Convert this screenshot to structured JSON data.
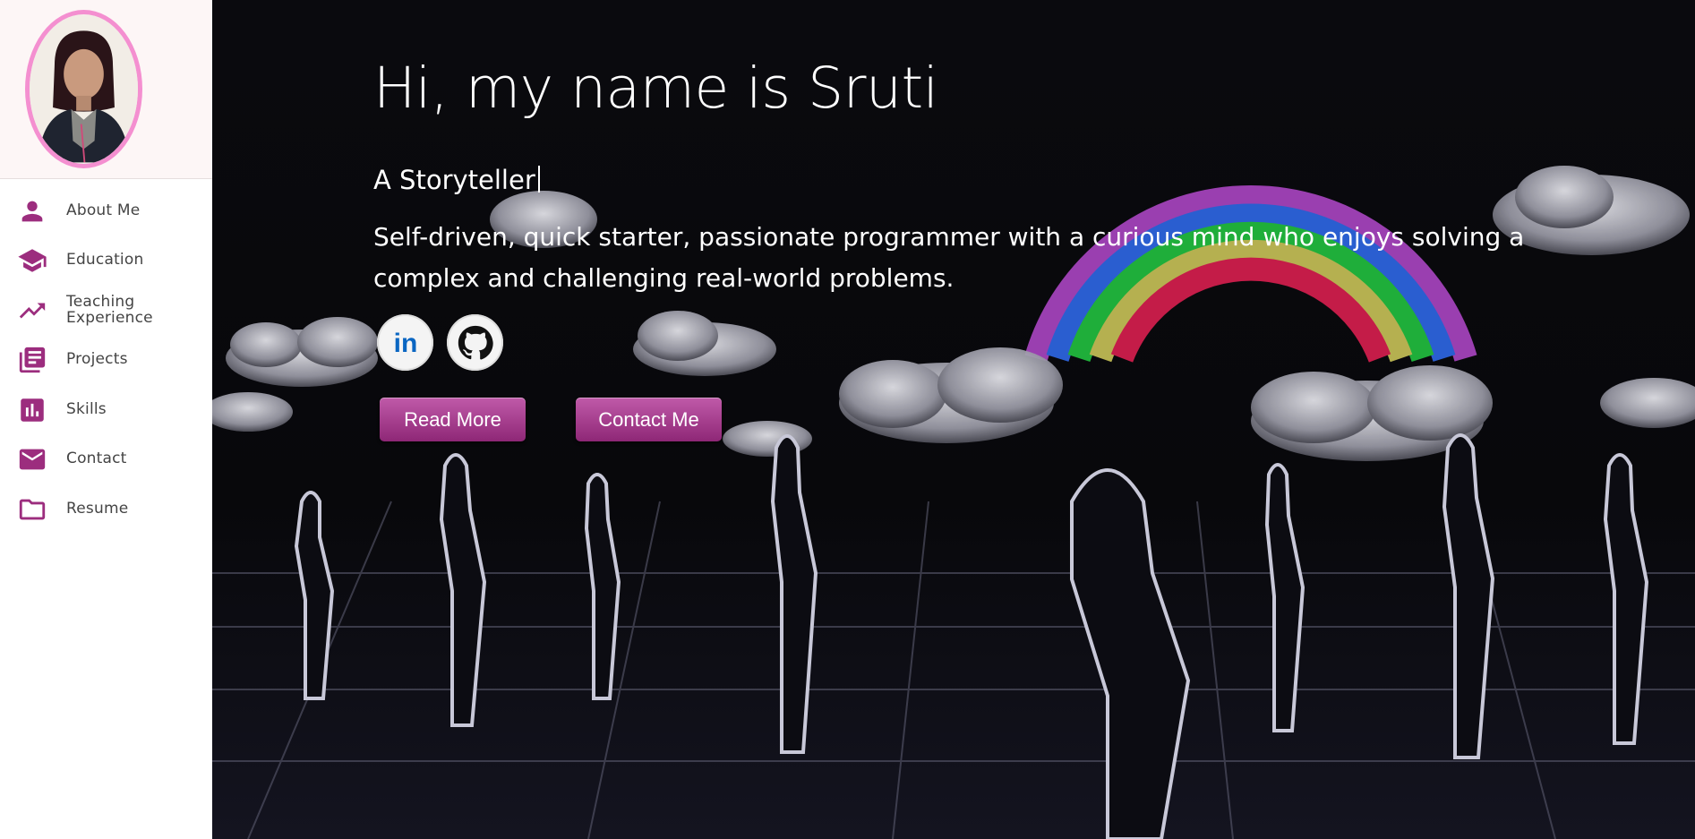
{
  "sidebar": {
    "items": [
      {
        "label": "About Me",
        "icon": "person-icon"
      },
      {
        "label": "Education",
        "icon": "graduation-cap-icon"
      },
      {
        "label": "Teaching Experience",
        "icon": "trending-up-icon"
      },
      {
        "label": "Projects",
        "icon": "library-books-icon"
      },
      {
        "label": "Skills",
        "icon": "bar-chart-icon"
      },
      {
        "label": "Contact",
        "icon": "mail-icon"
      },
      {
        "label": "Resume",
        "icon": "folder-icon"
      }
    ]
  },
  "hero": {
    "title": "Hi, my name is Sruti",
    "typed_text": "A Storyteller",
    "description": "Self-driven, quick starter, passionate programmer with a curious mind who enjoys solving a complex and challenging real-world problems.",
    "social": [
      {
        "name": "LinkedIn",
        "icon": "linkedin-icon",
        "text": "in"
      },
      {
        "name": "GitHub",
        "icon": "github-icon"
      }
    ],
    "read_more_label": "Read More",
    "contact_label": "Contact Me"
  },
  "colors": {
    "accent": "#9c2d7e",
    "avatar_border": "#f48fd0",
    "button_top": "#c05aa9",
    "button_bottom": "#8e2776"
  }
}
